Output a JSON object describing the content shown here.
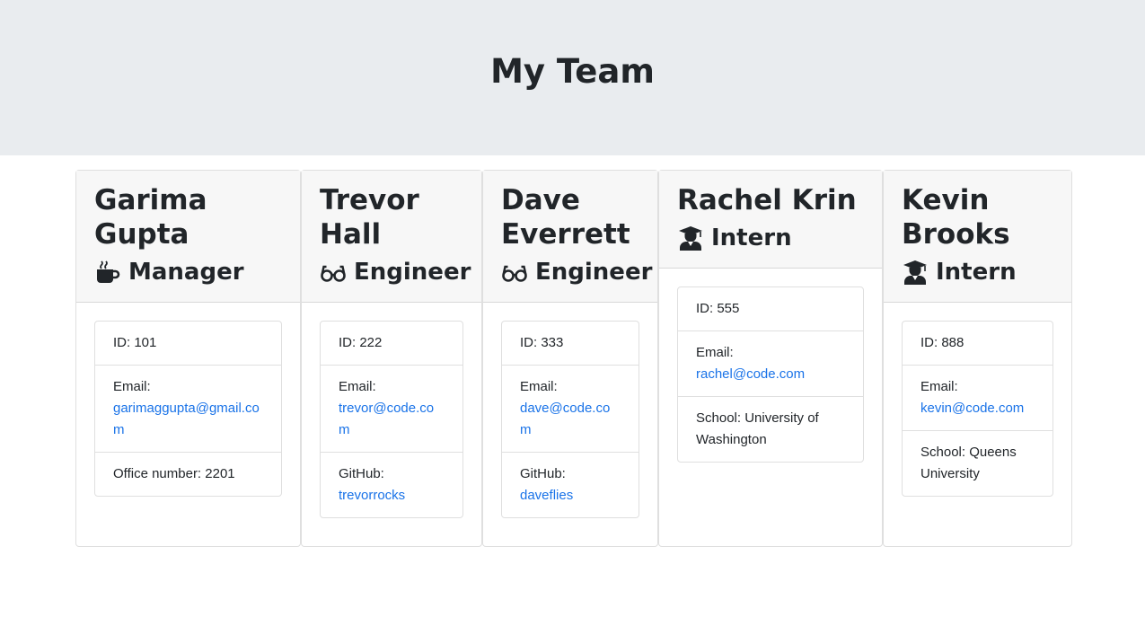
{
  "page_title": "My Team",
  "colors": {
    "link": "#1a73e8",
    "header_bg": "#e9ecef",
    "card_header_bg": "#f7f7f7"
  },
  "team": [
    {
      "name": "Garima Gupta",
      "role": "Manager",
      "role_icon": "mug-icon",
      "id_text": "ID: 101",
      "email_label": "Email:",
      "email": "garimaggupta@gmail.com",
      "extra_label": "Office number: 2201",
      "extra_link": ""
    },
    {
      "name": "Trevor Hall",
      "role": "Engineer",
      "role_icon": "glasses-icon",
      "id_text": "ID: 222",
      "email_label": "Email:",
      "email": "trevor@code.com",
      "extra_label": "GitHub:",
      "extra_link": "trevorrocks"
    },
    {
      "name": "Dave Everrett",
      "role": "Engineer",
      "role_icon": "glasses-icon",
      "id_text": "ID: 333",
      "email_label": "Email:",
      "email": "dave@code.com",
      "extra_label": "GitHub:",
      "extra_link": "daveflies"
    },
    {
      "name": "Rachel Krin",
      "role": "Intern",
      "role_icon": "graduate-icon",
      "id_text": "ID: 555",
      "email_label": "Email:",
      "email": "rachel@code.com",
      "extra_label": "School: University of Washington",
      "extra_link": ""
    },
    {
      "name": "Kevin Brooks",
      "role": "Intern",
      "role_icon": "graduate-icon",
      "id_text": "ID: 888",
      "email_label": "Email:",
      "email": "kevin@code.com",
      "extra_label": "School: Queens University",
      "extra_link": ""
    }
  ]
}
